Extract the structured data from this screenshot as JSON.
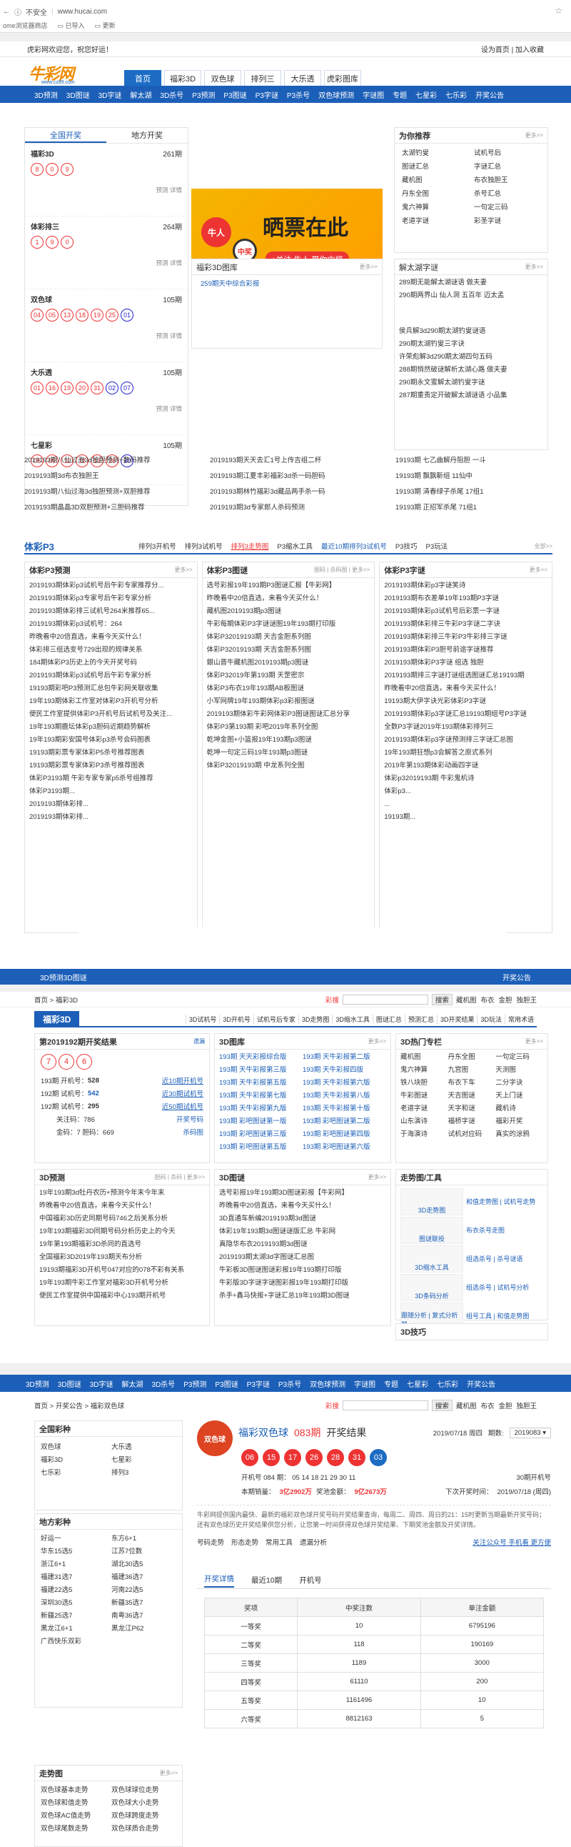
{
  "browser": {
    "insecure": "不安全",
    "url": "www.hucai.com",
    "bookmarks": [
      "ome浏览器商店",
      "已导入",
      "更新"
    ]
  },
  "header": {
    "welcome": "虎彩网欢迎您，祝您好运！",
    "set_home": "设为首页",
    "add_fav": "加入收藏",
    "logo_text": "牛彩网",
    "logo_domain": "www.cz89.com"
  },
  "tabs": [
    "首页",
    "福彩3D",
    "双色球",
    "排列三",
    "大乐透",
    "虎彩图库"
  ],
  "nav": [
    "3D预测",
    "3D图谜",
    "3D字谜",
    "解太湖",
    "3D杀号",
    "P3预测",
    "P3图谜",
    "P3字谜",
    "P3杀号",
    "双色球预测",
    "字谜图",
    "专题",
    "七星彩",
    "七乐彩",
    "开奖公告"
  ],
  "left": {
    "tab1": "全国开奖",
    "tab2": "地方开奖",
    "games": [
      {
        "name": "福彩3D",
        "issue": "261期",
        "balls": [
          "8",
          "0",
          "9"
        ],
        "blue": [],
        "links": "预测 详情"
      },
      {
        "name": "体彩排三",
        "issue": "264期",
        "balls": [
          "1",
          "9",
          "0"
        ],
        "blue": [],
        "links": "预测 详情"
      },
      {
        "name": "双色球",
        "issue": "105期",
        "balls": [
          "04",
          "05",
          "13",
          "18",
          "19",
          "25"
        ],
        "blue": [
          "01"
        ],
        "links": "预测 详情"
      },
      {
        "name": "大乐透",
        "issue": "105期",
        "balls": [
          "01",
          "16",
          "19",
          "20",
          "31"
        ],
        "blue": [
          "02",
          "07"
        ],
        "links": "预测 详情"
      },
      {
        "name": "七星彩",
        "issue": "105期",
        "balls": [
          "05",
          "09",
          "11",
          "12",
          "13",
          "28"
        ],
        "blue": [
          "30"
        ],
        "links": ""
      }
    ]
  },
  "banner": {
    "tag": "牛人",
    "tag2": "中奖",
    "title": "晒票在此",
    "sub": "+关注  牛人,带你中奖"
  },
  "tuku": {
    "title": "福彩3D图库",
    "more": "更多>>",
    "item": "259期天中综合彩报"
  },
  "recommend": {
    "title": "为你推荐",
    "more": "更多>>",
    "items": [
      "太湖钓叟",
      "试机号后",
      "图谜汇总",
      "字谜汇总",
      "藏机图",
      "布衣独胆王",
      "丹东全图",
      "杀号汇总",
      "鬼六神算",
      "一句定三码",
      "老道字谜",
      "彩圣字谜"
    ]
  },
  "taihu": {
    "title": "解太湖字谜",
    "more": "更多>>",
    "items": [
      "289期无能解太湖谜语 做夫妻",
      "290期两界山 仙人洞 五百年 迈太孟"
    ],
    "items2": [
      "侯兵解3d290期太湖钓叟谜语",
      "290期太湖钓叟三字诀",
      "许荣彪解3d290期太湖四句五码",
      "288期悄然破谜解析太湖心路 做夫妻",
      "290期永文蜜解太湖钓叟字谜",
      "287期重责定开破解太湖谜语 小品集"
    ]
  },
  "rows": [
    [
      "2019193期八仙过海3d独胆预测+数码推荐",
      "2019193期天天去汇1号上传吉组二杯",
      "19193期 七乙曲解丹阻胆 一斗"
    ],
    [
      "2019193期3d布衣独胆王",
      "2019193期江夏丰彩福彩3d杀一码胆码",
      "19193期 飘飘靳组 11仙中"
    ],
    [
      "2019193期八仙过海3d独胆预测+双胆推荐",
      "2019193期林竹福彩3d藏品两手杀一码",
      "19193期 清春绿子杀尾 17组1"
    ],
    [
      "2019193期晶晶3D双胆预测+三胆码推荐",
      "2019193期3d专家郎人杀码预测",
      "19193期 正招军杀尾 71组1"
    ]
  ],
  "p3": {
    "title": "体彩P3",
    "tabs": [
      "排列3开机号",
      "排列3试机号",
      "排列3走势图",
      "P3缩水工具",
      "最近10期排列3试机号",
      "P3技巧",
      "P3玩法"
    ],
    "more": "全部>>",
    "c1": {
      "title": "体彩P3预测",
      "more": "更多>>",
      "items": [
        "2019193期体彩p3试机号后午彩专家推荐分...",
        "2019193期体彩p3专家号后午彩专家分析",
        "2019193期体彩排三试机号264米推荐65...",
        "2019193期体彩p3试机号：264",
        "昨晚看中20倍直选，来看今天买什么！",
        "体彩排三组选变号729出现的规律关系",
        "184期体彩P3历史上的今天开奖号码",
        "2019193期体彩p3试机号后午彩专家分析",
        "19193期彩吧P3预测汇总包牛彩网关联收集",
        "19年193期体彩工作室对体彩P3开机号分析",
        "便民工作室提供体彩P3开机号后试机号及关注...",
        "19年193期鹿坛体彩p3胆码近期趋势解析",
        "19年193期彩安国号体彩p3杀号会码图表",
        "19193期彩票专家体彩P5杀号推荐图表",
        "19193期彩票专家体彩P3杀号推荐图表",
        "体彩P3193期 午彩专家专家p5杀号组推荐",
        "体彩P3193期...",
        "2019193期体彩排...",
        "2019193期体彩排..."
      ]
    },
    "c2": {
      "title": "体彩P3图谜",
      "links": "图码 | 杀码图 | 更多>>",
      "items": [
        "选号彩报19年193期P3图谜汇报【牛彩网】",
        "昨晚看中20倍直选，来看今天买什么！",
        "藏机图2019193期p3图谜",
        "牛彩每期体彩P3字谜谜图19年193期打印版",
        "体彩P32019193期 天吉金胆系列图",
        "体彩P32019193期 天吉金胆系列图",
        "銀山晋牛藏机图2019193期p3图谜",
        "体彩P32019年第193期 天罡密宗",
        "体彩P3布衣19年193期AB板图谜",
        "小军网牌19年193期体彩p3彩报图谜",
        "2019193期体彩牛彩网体彩P3图谜图谜汇总分享",
        "体彩P3第193期 彩吧2019年系列全图",
        "乾坤金图+小篮报19年193期p3图谜",
        "乾坤一句定三码19年193期p3图谜",
        "体彩P32019193期 中龙系列全图"
      ]
    },
    "c3": {
      "title": "体彩P3字谜",
      "more": "更多>>",
      "items": [
        "2019193期体彩p3字谜笑诗",
        "2019193期布衣差单19年193期P3字谜",
        "2019193期体彩p3试机号后彩票一字谜",
        "2019193期体彩排三牛彩P3字谜二字诀",
        "2019193期体彩排三牛彩P3牛彩排三字谜",
        "2019193期体彩P3胆号前途字谜推荐",
        "2019193期体彩P3字谜 组选 独胆",
        "2019193期排三字谜打谜组选图谜汇总19193期",
        "昨晚看中20倍直选，来看今天买什么！",
        "19193期大伊字诀光彩体彩P3字谜",
        "2019193期体彩p3字谜汇总19193期组号P3字谜",
        "全数P3字谜2019年193期体彩排列三",
        "2019193期体彩p3字谜预测排三字谜汇总图",
        "19年193期狂想p3会解答之原式系列",
        "2019年第193期体彩动画四字谜",
        "体彩p32019193期 牛彩鬼机诗",
        "体彩p3...",
        "...",
        "19193期..."
      ]
    }
  },
  "bottom_nav": {
    "left": "3D预测",
    "mid": "3D图谜",
    "right": "开奖公告"
  },
  "s2": {
    "crumb": "首页 > 福彩3D",
    "search": "搜索",
    "hot": [
      "藏机图",
      "布衣",
      "金胆",
      "独胆王"
    ],
    "hot_label": "彩搜",
    "title": "福彩3D",
    "tabs": [
      "3D试机号",
      "3D开机号",
      "试机号后专家",
      "3D走势图",
      "3D缩水工具",
      "图谜汇总",
      "预测汇总",
      "3D开奖结果",
      "3D玩法",
      "常用术语"
    ],
    "draw": {
      "title": "第2019192期开奖结果",
      "link": "遗漏",
      "balls": [
        "7",
        "4",
        "6"
      ],
      "rows": [
        [
          "193期 开机号：",
          "528",
          "近10期开机号"
        ],
        [
          "192期 试机号：",
          "542",
          "近30期试机号"
        ],
        [
          "192期 试机号：",
          "295",
          "近50期试机号"
        ]
      ],
      "focus": "关注码：786",
      "gold": "金码：7  胆码：669",
      "links": [
        "开奖号码",
        "杀码图",
        "试机后预测"
      ]
    },
    "tuku": {
      "title": "3D图库",
      "more": "更多>>",
      "items": [
        [
          "193期 天天彩报综合版",
          "193期 天牛彩报第二版"
        ],
        [
          "193期 天牛彩报第三版",
          "193期 天牛彩报四版"
        ],
        [
          "193期 天牛彩报第五版",
          "193期 天牛彩报第六版"
        ],
        [
          "193期 天牛彩报第七版",
          "193期 天牛彩报第八版"
        ],
        [
          "193期 天牛彩报第九版",
          "193期 天牛彩报第十版"
        ],
        [
          "193期 彩吧图谜第一版",
          "193期 彩吧图谜第二版"
        ],
        [
          "193期 彩吧图谜第三版",
          "193期 彩吧图谜第四版"
        ],
        [
          "193期 彩吧图谜第五版",
          "193期 彩吧图谜第六版"
        ]
      ]
    },
    "hot3": {
      "title": "3D热门专栏",
      "more": "更多>>",
      "items": [
        "藏机图",
        "丹东全图",
        "一句定三码",
        "鬼六神算",
        "九宫图",
        "天测图",
        "铁八块胆",
        "布衣下车",
        "二分字诀",
        "牛彩图谜",
        "天吉图谜",
        "天上门谜",
        "老道字谜",
        "天字和谜",
        "藏机诗",
        "山东演诗",
        "福桥字谜",
        "福彩开奖",
        "于海演诗",
        "试机对应码",
        "真实的涂鸦"
      ]
    },
    "pred": {
      "title": "3D预测",
      "links": "胆码 | 杀码 | 更多>>",
      "items": [
        "19年193期3d牡丹农历+预测今年末今年末",
        "昨晚看中20倍直选，来看今天买什么！",
        "中国福彩3D历史同期号码746之后关系分析",
        "19年193期福彩3D同期号码分析历史上的今天",
        "19年第193期福彩3D杀同的直选号",
        "全国福彩3D2019年193期天布分析",
        "19193期福彩3D开机号047对应的078不彩有关系",
        "19年193期牛彩工作室对福彩3D开机号分析",
        "便民工作室提供中国福彩中心193期开机号"
      ]
    },
    "tumi": {
      "title": "3D图谜",
      "more": "更多>>",
      "items": [
        "选号彩报19年193期3D图谜彩报【牛彩网】",
        "昨晚看中20倍直选，来看今天买什么！",
        "3D直通车新编2019193期3d图谜",
        "体彩19年193期3d图谜谜版汇总 牛彩网",
        "真隐华布衣2019193期3d图谜",
        "2019193期太湖3d字图谜汇总图",
        "牛彩板3D图谜图谜彩报19年193期打印版",
        "牛彩版3D字谜字谜图彩报19年193期打印版",
        "杀手+鑫马快报+字谜汇总19年193期3D图谜"
      ]
    },
    "tools": {
      "title": "走势图/工具",
      "items": [
        "3D走势图",
        "和值走势图 | 试机号走势",
        "图谜联投",
        "布衣杀号走图",
        "3D缩水工具",
        "组选杀号 | 杀号谜语",
        "3D条码分析",
        "组选杀号 | 试机号分析",
        "跟随分析 | 复式分析器",
        "组号工具 | 和值走势图"
      ]
    },
    "skills": {
      "title": "3D技巧"
    }
  },
  "s3": {
    "nav": [
      "3D预测",
      "3D图谜",
      "3D字谜",
      "解太湖",
      "3D杀号",
      "P3预测",
      "P3图谜",
      "P3字谜",
      "P3杀号",
      "双色球预测",
      "字谜图",
      "专题",
      "七星彩",
      "七乐彩",
      "开奖公告"
    ],
    "crumb": "首页 > 开奖公告 > 福彩双色球",
    "search": "搜索",
    "hot": [
      "藏机图",
      "布衣",
      "金胆",
      "独胆王"
    ],
    "hot_label": "彩搜",
    "left": {
      "title": "全国彩种",
      "items": [
        "双色球",
        "大乐透",
        "福彩3D",
        "七星彩",
        "七乐彩",
        "排列3"
      ],
      "local_title": "地方彩种",
      "local": [
        "好运一",
        "东方6+1",
        "华东15选5",
        "江苏7位数",
        "浙江6+1",
        "湖北30选5",
        "福建31选7",
        "福建36选7",
        "福建22选5",
        "河南22选5",
        "深圳30选5",
        "新疆35选7",
        "新疆25选7",
        "南粤36选7",
        "黑龙江6+1",
        "黑龙江P62",
        "广西快乐双彩"
      ],
      "trend_title": "走势图",
      "trend": [
        "双色球基本走势",
        "双色球球位走势",
        "双色球和值走势",
        "双色球大小走势",
        "双色球AC值走势",
        "双色球跨度走势",
        "双色球尾数走势",
        "双色球质合走势"
      ]
    },
    "result": {
      "name": "福彩双色球",
      "issue": "083期",
      "label": "开奖结果",
      "date": "2019/07/18 周四",
      "period_label": "期数:",
      "period": "2019083",
      "balls": [
        "06",
        "15",
        "17",
        "26",
        "28",
        "31"
      ],
      "blue": "03",
      "open": "开机号 084 期： 05 14 18 21 29 30 11",
      "test": "30期开机号",
      "sales_label": "本期销量：",
      "sales": "3亿2902万",
      "pool_label": "奖池金额：",
      "pool": "9亿2673万",
      "next_label": "下次开奖时间：",
      "next": "2019/07/18 (周四)",
      "desc": "牛彩网提供国内最快、最新的福彩双色球开奖号码开奖结果查询，每周二、周四、周日的21：15时更新当期最新开奖号码；还有双色球历史开奖结果供您分析，让您第一时间获得双色球开奖结果、下期奖池金额及开奖详情。",
      "links": [
        "号码走势",
        "形态走势",
        "常用工具",
        "遗漏分析"
      ],
      "follow": "关注公众号 手机看 更方便"
    },
    "detail": {
      "tabs": [
        "开奖详情",
        "最近10期",
        "开机号"
      ],
      "head": [
        "奖项",
        "中奖注数",
        "单注金额"
      ],
      "rows": [
        [
          "一等奖",
          "10",
          "6795196"
        ],
        [
          "二等奖",
          "118",
          "190169"
        ],
        [
          "三等奖",
          "1189",
          "3000"
        ],
        [
          "四等奖",
          "61110",
          "200"
        ],
        [
          "五等奖",
          "1161496",
          "10"
        ],
        [
          "六等奖",
          "8812163",
          "5"
        ]
      ]
    }
  }
}
